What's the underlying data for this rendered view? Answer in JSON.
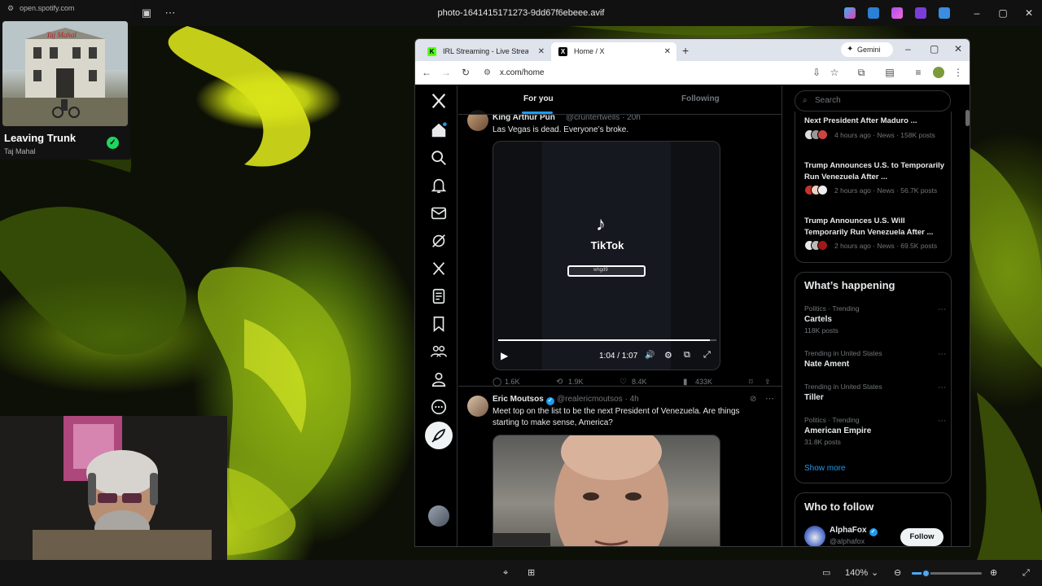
{
  "viewer": {
    "filename": "photo-1641415171273-9dd67f6ebeee.avif",
    "zoom": "140%",
    "zoom_fraction": 0.2
  },
  "spotify": {
    "url": "open.spotify.com",
    "track": "Leaving Trunk",
    "artist": "Taj Mahal"
  },
  "browser": {
    "tabs": [
      {
        "label": "IRL Streaming - Live Streams on",
        "favicon": "K",
        "active": false
      },
      {
        "label": "Home / X",
        "favicon": "X",
        "active": true
      }
    ],
    "gemini_label": "Gemini",
    "url": "x.com/home"
  },
  "x": {
    "feed_tabs": {
      "for_you": "For you",
      "following": "Following"
    },
    "post1": {
      "name": "King Arthur Pun",
      "handle": "@cruntertwells · 20h",
      "text": "Las Vegas is dead. Everyone’s broke.",
      "video_brand": "TikTok",
      "video_search": "whgd9",
      "video_time": "1:04 / 1:07",
      "video_progress": 0.97,
      "stats": {
        "replies": "1.6K",
        "reposts": "1.9K",
        "likes": "8.4K",
        "views": "433K"
      }
    },
    "post2": {
      "name": "Eric Moutsos",
      "handle": "@realericmoutsos · 4h",
      "text": "Meet top on the list to be the next President of Venezuela. Are things starting to make sense, America?"
    },
    "sidebar": {
      "search_placeholder": "Search",
      "news": [
        {
          "title": "Next President After Maduro ...",
          "meta": "4 hours ago · News · 158K posts"
        },
        {
          "title": "Trump Announces U.S. to Temporarily Run Venezuela After ...",
          "meta": "2 hours ago · News · 56.7K posts"
        },
        {
          "title": "Trump Announces U.S. Will Temporarily Run Venezuela After ...",
          "meta": "2 hours ago · News · 69.5K posts"
        }
      ],
      "happening_title": "What’s happening",
      "trends": [
        {
          "category": "Politics · Trending",
          "name": "Cartels",
          "count": "118K posts"
        },
        {
          "category": "Trending in United States",
          "name": "Nate Ament",
          "count": ""
        },
        {
          "category": "Trending in United States",
          "name": "Tiller",
          "count": ""
        },
        {
          "category": "Politics · Trending",
          "name": "American Empire",
          "count": "31.8K posts"
        }
      ],
      "show_more": "Show more",
      "who_to_follow_title": "Who to follow",
      "follow_suggestion": {
        "name": "AlphaFox",
        "handle": "@alphafox",
        "button": "Follow"
      }
    }
  }
}
